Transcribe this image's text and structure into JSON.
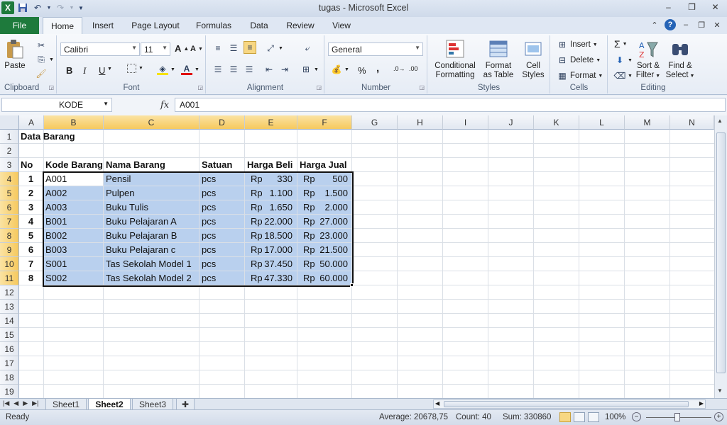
{
  "window": {
    "title": "tugas  -  Microsoft Excel",
    "controls": [
      "–",
      "❐",
      "✕"
    ]
  },
  "ribbon_tabs": [
    "File",
    "Home",
    "Insert",
    "Page Layout",
    "Formulas",
    "Data",
    "Review",
    "View"
  ],
  "ribbon": {
    "clipboard": {
      "paste": "Paste",
      "label": "Clipboard"
    },
    "font": {
      "name": "Calibri",
      "size": "11",
      "label": "Font",
      "bold": "B",
      "italic": "I",
      "underline": "U",
      "grow": "A",
      "shrink": "A",
      "fontcolor": "A"
    },
    "alignment": {
      "label": "Alignment"
    },
    "number": {
      "format": "General",
      "label": "Number",
      "percent": "%",
      "comma": ","
    },
    "styles": {
      "conditional": "Conditional\nFormatting",
      "conditional1": "Conditional",
      "conditional2": "Formatting",
      "table1": "Format",
      "table2": "as Table",
      "cell1": "Cell",
      "cell2": "Styles",
      "label": "Styles"
    },
    "cells": {
      "insert": "Insert",
      "delete": "Delete",
      "format": "Format",
      "label": "Cells"
    },
    "editing": {
      "sum": "Σ",
      "sort1": "Sort &",
      "sort2": "Filter",
      "find1": "Find &",
      "find2": "Select",
      "label": "Editing"
    }
  },
  "formula_bar": {
    "name_box": "KODE",
    "fx": "fx",
    "value": "A001"
  },
  "columns": [
    "A",
    "B",
    "C",
    "D",
    "E",
    "F",
    "G",
    "H",
    "I",
    "J",
    "K",
    "L",
    "M",
    "N"
  ],
  "rows": [
    "1",
    "2",
    "3",
    "4",
    "5",
    "6",
    "7",
    "8",
    "9",
    "10",
    "11",
    "12",
    "13",
    "14",
    "15",
    "16",
    "17",
    "18",
    "19"
  ],
  "sheet": {
    "title": "Data Barang",
    "headers": {
      "no": "No",
      "kode": "Kode Barang",
      "nama": "Nama Barang",
      "satuan": "Satuan",
      "beli": "Harga Beli",
      "jual": "Harga Jual"
    },
    "currency": "Rp",
    "data": [
      {
        "no": "1",
        "kode": "A001",
        "nama": "Pensil",
        "satuan": "pcs",
        "beli": "330",
        "jual": "500"
      },
      {
        "no": "2",
        "kode": "A002",
        "nama": "Pulpen",
        "satuan": "pcs",
        "beli": "1.100",
        "jual": "1.500"
      },
      {
        "no": "3",
        "kode": "A003",
        "nama": "Buku Tulis",
        "satuan": "pcs",
        "beli": "1.650",
        "jual": "2.000"
      },
      {
        "no": "4",
        "kode": "B001",
        "nama": "Buku Pelajaran A",
        "satuan": "pcs",
        "beli": "22.000",
        "jual": "27.000"
      },
      {
        "no": "5",
        "kode": "B002",
        "nama": "Buku Pelajaran B",
        "satuan": "pcs",
        "beli": "18.500",
        "jual": "23.000"
      },
      {
        "no": "6",
        "kode": "B003",
        "nama": "Buku Pelajaran c",
        "satuan": "pcs",
        "beli": "17.000",
        "jual": "21.500"
      },
      {
        "no": "7",
        "kode": "S001",
        "nama": "Tas Sekolah Model 1",
        "satuan": "pcs",
        "beli": "37.450",
        "jual": "50.000"
      },
      {
        "no": "8",
        "kode": "S002",
        "nama": "Tas Sekolah Model 2",
        "satuan": "pcs",
        "beli": "47.330",
        "jual": "60.000"
      }
    ]
  },
  "sheet_tabs": [
    "Sheet1",
    "Sheet2",
    "Sheet3"
  ],
  "active_sheet": "Sheet2",
  "status": {
    "ready": "Ready",
    "average": "Average: 20678,75",
    "count": "Count: 40",
    "sum": "Sum: 330860",
    "zoom": "100%"
  },
  "colors": {
    "accent": "#1e7a3c",
    "selection": "#b9d0ee",
    "header_selected": "#f6c95e"
  },
  "icons": [
    "excel-logo-icon",
    "save-icon",
    "undo-icon",
    "redo-icon",
    "paste-icon",
    "cut-icon",
    "copy-icon",
    "format-painter-icon",
    "help-icon",
    "conditional-formatting-icon",
    "format-as-table-icon",
    "cell-styles-icon",
    "sort-filter-icon",
    "find-select-icon"
  ]
}
